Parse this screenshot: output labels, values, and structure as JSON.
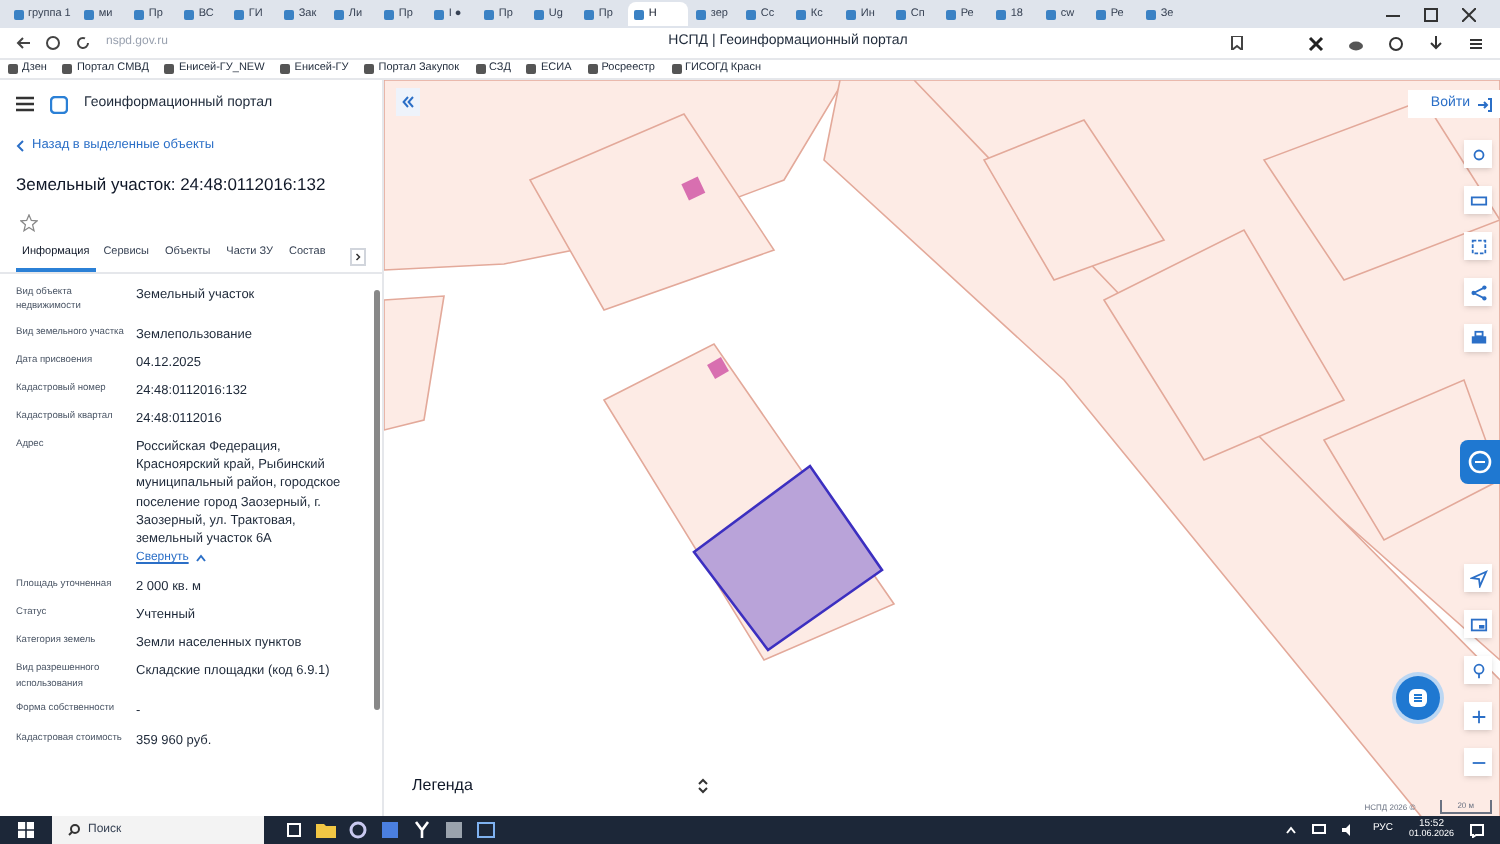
{
  "browser": {
    "tabs": [
      {
        "label": "группа 1",
        "selected": false
      },
      {
        "label": "ми",
        "selected": false
      },
      {
        "label": "Пр",
        "selected": false
      },
      {
        "label": "ВС",
        "selected": false
      },
      {
        "label": "ГИ",
        "selected": false
      },
      {
        "label": "Зак",
        "selected": false
      },
      {
        "label": "Ли",
        "selected": false
      },
      {
        "label": "Пр",
        "selected": false
      },
      {
        "label": "I ●",
        "selected": false
      },
      {
        "label": "Пр",
        "selected": false
      },
      {
        "label": "Ug",
        "selected": false
      },
      {
        "label": "Пр",
        "selected": false
      },
      {
        "label": "Н",
        "selected": true
      },
      {
        "label": "зер",
        "selected": false
      },
      {
        "label": "Сс",
        "selected": false
      },
      {
        "label": "Кс",
        "selected": false
      },
      {
        "label": "Ин",
        "selected": false
      },
      {
        "label": "Сп",
        "selected": false
      },
      {
        "label": "Ре",
        "selected": false
      },
      {
        "label": "18",
        "selected": false
      },
      {
        "label": "cw",
        "selected": false
      },
      {
        "label": "Ре",
        "selected": false
      },
      {
        "label": "Зе",
        "selected": false
      }
    ],
    "address": "nspd.gov.ru",
    "page_title": "НСПД | Геоинформационный портал",
    "bookmarks": [
      "Дзен",
      "Портал СМВД",
      "Енисей-ГУ_NEW",
      "Енисей-ГУ",
      "Портал Закупок",
      "СЗД",
      "ЕСИА",
      "Росреестр",
      "ГИСОГД Красн"
    ]
  },
  "app": {
    "title": "Геоинформационный портал",
    "login": "Войти"
  },
  "panel": {
    "back": "Назад в выделенные объекты",
    "title": "Земельный участок: 24:48:0112016:132",
    "tabs": [
      {
        "label": "Информация",
        "selected": true
      },
      {
        "label": "Сервисы",
        "selected": false
      },
      {
        "label": "Объекты",
        "selected": false
      },
      {
        "label": "Части ЗУ",
        "selected": false
      },
      {
        "label": "Состав",
        "selected": false
      }
    ],
    "fields": [
      {
        "label": "Вид объекта недвижимости",
        "value": "Земельный участок"
      },
      {
        "label": "Вид земельного участка",
        "value": "Землепользование"
      },
      {
        "label": "Дата присвоения",
        "value": "04.12.2025"
      },
      {
        "label": "Кадастровый номер",
        "value": "24:48:0112016:132"
      },
      {
        "label": "Кадастровый квартал",
        "value": "24:48:0112016"
      },
      {
        "label": "Адрес",
        "value": "Российская Федерация, Красноярский край, Рыбинский муниципальный район, городское поселение город Заозерный, г. Заозерный, ул. Трактовая, земельный участок 6А",
        "link": "Свернуть"
      },
      {
        "label": "Площадь уточненная",
        "value": "2 000 кв. м"
      },
      {
        "label": "Статус",
        "value": "Учтенный"
      },
      {
        "label": "Категория земель",
        "value": "Земли населенных пунктов"
      },
      {
        "label": "Вид разрешенного использования",
        "value": "Складские площадки (код 6.9.1)"
      },
      {
        "label": "Форма собственности",
        "value": "-"
      },
      {
        "label": "Кадастровая стоимость",
        "value": "359 960 руб."
      }
    ]
  },
  "map": {
    "legend": "Легенда",
    "copyright": "НСПД 2026 ©",
    "scale": "20 м"
  },
  "taskbar": {
    "search_placeholder": "Поиск",
    "language": "РУС",
    "time": "15:52",
    "date": "01.06.2026"
  }
}
